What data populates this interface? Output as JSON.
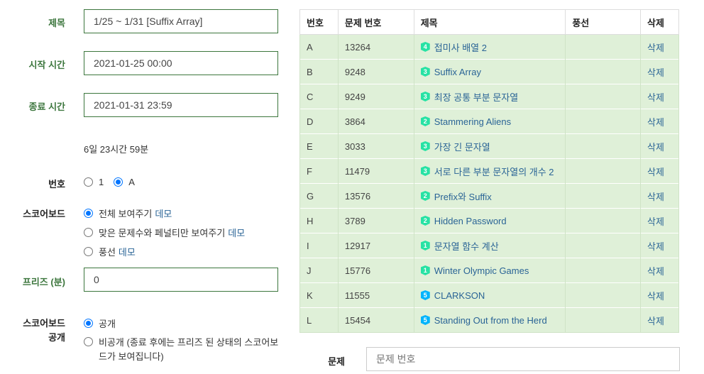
{
  "form": {
    "title_label": "제목",
    "title_value": "1/25 ~ 1/31 [Suffix Array]",
    "start_label": "시작 시간",
    "start_value": "2021-01-25 00:00",
    "end_label": "종료 시간",
    "end_value": "2021-01-31 23:59",
    "duration": "6일 23시간 59분",
    "numbering_label": "번호",
    "numbering_options": [
      {
        "label": "1",
        "checked": false
      },
      {
        "label": "A",
        "checked": true
      }
    ],
    "scoreboard_label": "스코어보드",
    "scoreboard_options": [
      {
        "label": "전체 보여주기",
        "link": "데모",
        "checked": true
      },
      {
        "label": "맞은 문제수와 페널티만 보여주기",
        "link": "데모",
        "checked": false
      },
      {
        "label": "풍선",
        "link": "데모",
        "checked": false
      }
    ],
    "freeze_label": "프리즈 (분)",
    "freeze_value": "0",
    "public_label_1": "스코어보드",
    "public_label_2": "공개",
    "public_options": [
      {
        "label": "공개",
        "checked": true
      },
      {
        "label_line1": "비공개 (종료 후에는 프리즈 된 상태의 스코어보",
        "label_line2": "드가 보여집니다)",
        "checked": false
      }
    ]
  },
  "table": {
    "headers": [
      "번호",
      "문제 번호",
      "제목",
      "풍선",
      "삭제"
    ],
    "rows": [
      {
        "num": "A",
        "pid": "13264",
        "tier": "4",
        "tier_color": "#27e2a4",
        "title": "접미사 배열 2",
        "balloon": "",
        "delete": "삭제"
      },
      {
        "num": "B",
        "pid": "9248",
        "tier": "3",
        "tier_color": "#27e2a4",
        "title": "Suffix Array",
        "balloon": "",
        "delete": "삭제"
      },
      {
        "num": "C",
        "pid": "9249",
        "tier": "3",
        "tier_color": "#27e2a4",
        "title": "최장 공통 부분 문자열",
        "balloon": "",
        "delete": "삭제"
      },
      {
        "num": "D",
        "pid": "3864",
        "tier": "2",
        "tier_color": "#27e2a4",
        "title": "Stammering Aliens",
        "balloon": "",
        "delete": "삭제"
      },
      {
        "num": "E",
        "pid": "3033",
        "tier": "3",
        "tier_color": "#27e2a4",
        "title": "가장 긴 문자열",
        "balloon": "",
        "delete": "삭제"
      },
      {
        "num": "F",
        "pid": "11479",
        "tier": "3",
        "tier_color": "#27e2a4",
        "title": "서로 다른 부분 문자열의 개수 2",
        "balloon": "",
        "delete": "삭제"
      },
      {
        "num": "G",
        "pid": "13576",
        "tier": "2",
        "tier_color": "#27e2a4",
        "title": "Prefix와 Suffix",
        "balloon": "",
        "delete": "삭제"
      },
      {
        "num": "H",
        "pid": "3789",
        "tier": "2",
        "tier_color": "#27e2a4",
        "title": "Hidden Password",
        "balloon": "",
        "delete": "삭제"
      },
      {
        "num": "I",
        "pid": "12917",
        "tier": "1",
        "tier_color": "#27e2a4",
        "title": "문자열 함수 계산",
        "balloon": "",
        "delete": "삭제"
      },
      {
        "num": "J",
        "pid": "15776",
        "tier": "1",
        "tier_color": "#27e2a4",
        "title": "Winter Olympic Games",
        "balloon": "",
        "delete": "삭제"
      },
      {
        "num": "K",
        "pid": "11555",
        "tier": "5",
        "tier_color": "#00b4fc",
        "title": "CLARKSON",
        "balloon": "",
        "delete": "삭제"
      },
      {
        "num": "L",
        "pid": "15454",
        "tier": "5",
        "tier_color": "#00b4fc",
        "title": "Standing Out from the Herd",
        "balloon": "",
        "delete": "삭제"
      }
    ]
  },
  "problem_add": {
    "label": "문제",
    "placeholder": "문제 번호"
  }
}
